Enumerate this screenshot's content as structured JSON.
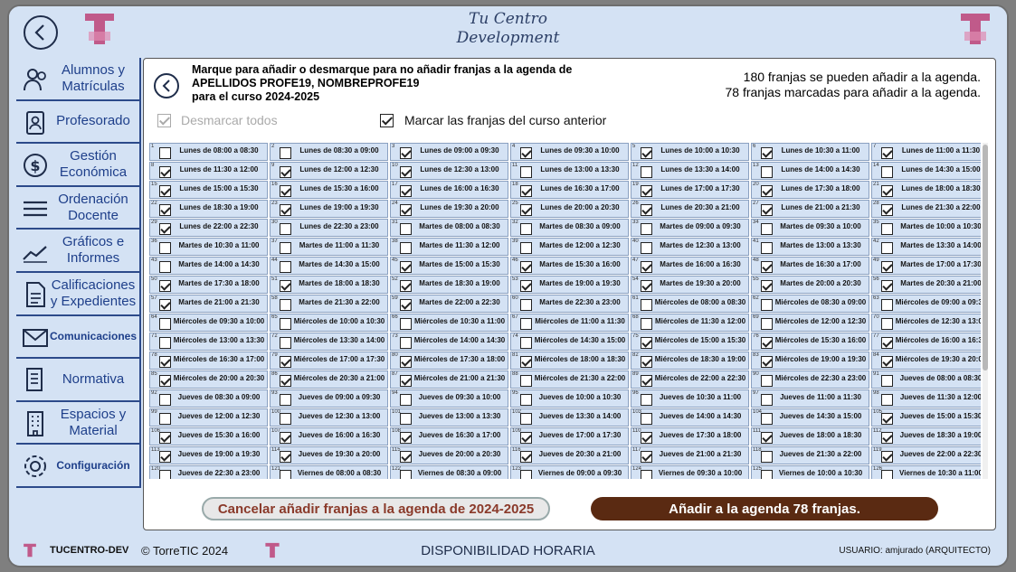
{
  "header": {
    "title_line1": "Tu Centro",
    "title_line2": "Development",
    "logo_text": "TuCentro"
  },
  "sidebar": {
    "items": [
      {
        "label": "Alumnos y Matrículas",
        "icon": "users-icon"
      },
      {
        "label": "Profesorado",
        "icon": "teacher-icon"
      },
      {
        "label": "Gestión Económica",
        "icon": "money-icon"
      },
      {
        "label": "Ordenación Docente",
        "icon": "list-icon"
      },
      {
        "label": "Gráficos e Informes",
        "icon": "chart-icon"
      },
      {
        "label": "Calificaciones y Expedientes",
        "icon": "document-icon"
      },
      {
        "label": "Comunicaciones",
        "icon": "mail-icon"
      },
      {
        "label": "Normativa",
        "icon": "scroll-icon"
      },
      {
        "label": "Espacios y Material",
        "icon": "building-icon"
      },
      {
        "label": "Configuración",
        "icon": "gear-icon"
      }
    ]
  },
  "main": {
    "instruction_line1": "Marque para añadir o desmarque para no añadir franjas a la agenda de",
    "instruction_line2": "APELLIDOS PROFE19, NOMBREPROFE19",
    "instruction_line3": "para el curso 2024-2025",
    "count_line1": "180 franjas se pueden añadir a la agenda.",
    "count_line2": "78 franjas marcadas para añadir a la agenda.",
    "uncheck_all_label": "Desmarcar todos",
    "mark_previous_label": "Marcar las franjas del curso anterior",
    "cancel_label": "Cancelar añadir franjas a la agenda de 2024-2025",
    "add_label": "Añadir a la agenda 78 franjas."
  },
  "slots": [
    {
      "n": "1",
      "label": "Lunes de 08:00 a 08:30",
      "checked": false
    },
    {
      "n": "2",
      "label": "Lunes de 08:30 a 09:00",
      "checked": false
    },
    {
      "n": "3",
      "label": "Lunes de 09:00 a 09:30",
      "checked": true
    },
    {
      "n": "4",
      "label": "Lunes de 09:30 a 10:00",
      "checked": true
    },
    {
      "n": "5",
      "label": "Lunes de 10:00 a 10:30",
      "checked": true
    },
    {
      "n": "6",
      "label": "Lunes de 10:30 a 11:00",
      "checked": true
    },
    {
      "n": "7",
      "label": "Lunes de 11:00 a 11:30",
      "checked": true
    },
    {
      "n": "8",
      "label": "Lunes de 11:30 a 12:00",
      "checked": true
    },
    {
      "n": "9",
      "label": "Lunes de 12:00 a 12:30",
      "checked": true
    },
    {
      "n": "10",
      "label": "Lunes de 12:30 a 13:00",
      "checked": true
    },
    {
      "n": "11",
      "label": "Lunes de 13:00 a 13:30",
      "checked": false
    },
    {
      "n": "12",
      "label": "Lunes de 13:30 a 14:00",
      "checked": false
    },
    {
      "n": "13",
      "label": "Lunes de 14:00 a 14:30",
      "checked": false
    },
    {
      "n": "14",
      "label": "Lunes de 14:30 a 15:00",
      "checked": false
    },
    {
      "n": "15",
      "label": "Lunes de 15:00 a 15:30",
      "checked": true
    },
    {
      "n": "16",
      "label": "Lunes de 15:30 a 16:00",
      "checked": true
    },
    {
      "n": "17",
      "label": "Lunes de 16:00 a 16:30",
      "checked": true
    },
    {
      "n": "18",
      "label": "Lunes de 16:30 a 17:00",
      "checked": true
    },
    {
      "n": "19",
      "label": "Lunes de 17:00 a 17:30",
      "checked": true
    },
    {
      "n": "20",
      "label": "Lunes de 17:30 a 18:00",
      "checked": true
    },
    {
      "n": "21",
      "label": "Lunes de 18:00 a 18:30",
      "checked": true
    },
    {
      "n": "22",
      "label": "Lunes de 18:30 a 19:00",
      "checked": true
    },
    {
      "n": "23",
      "label": "Lunes de 19:00 a 19:30",
      "checked": true
    },
    {
      "n": "24",
      "label": "Lunes de 19:30 a 20:00",
      "checked": true
    },
    {
      "n": "25",
      "label": "Lunes de 20:00 a 20:30",
      "checked": true
    },
    {
      "n": "26",
      "label": "Lunes de 20:30 a 21:00",
      "checked": true
    },
    {
      "n": "27",
      "label": "Lunes de 21:00 a 21:30",
      "checked": true
    },
    {
      "n": "28",
      "label": "Lunes de 21:30 a 22:00",
      "checked": true
    },
    {
      "n": "29",
      "label": "Lunes de 22:00 a 22:30",
      "checked": true
    },
    {
      "n": "30",
      "label": "Lunes de 22:30 a 23:00",
      "checked": false
    },
    {
      "n": "31",
      "label": "Martes de 08:00 a 08:30",
      "checked": false
    },
    {
      "n": "32",
      "label": "Martes de 08:30 a 09:00",
      "checked": false
    },
    {
      "n": "33",
      "label": "Martes de 09:00 a 09:30",
      "checked": false
    },
    {
      "n": "34",
      "label": "Martes de 09:30 a 10:00",
      "checked": false
    },
    {
      "n": "35",
      "label": "Martes de 10:00 a 10:30",
      "checked": false
    },
    {
      "n": "36",
      "label": "Martes de 10:30 a 11:00",
      "checked": false
    },
    {
      "n": "37",
      "label": "Martes de 11:00 a 11:30",
      "checked": false
    },
    {
      "n": "38",
      "label": "Martes de 11:30 a 12:00",
      "checked": false
    },
    {
      "n": "39",
      "label": "Martes de 12:00 a 12:30",
      "checked": false
    },
    {
      "n": "40",
      "label": "Martes de 12:30 a 13:00",
      "checked": false
    },
    {
      "n": "41",
      "label": "Martes de 13:00 a 13:30",
      "checked": false
    },
    {
      "n": "42",
      "label": "Martes de 13:30 a 14:00",
      "checked": false
    },
    {
      "n": "43",
      "label": "Martes de 14:00 a 14:30",
      "checked": false
    },
    {
      "n": "44",
      "label": "Martes de 14:30 a 15:00",
      "checked": false
    },
    {
      "n": "45",
      "label": "Martes de 15:00 a 15:30",
      "checked": true
    },
    {
      "n": "46",
      "label": "Martes de 15:30 a 16:00",
      "checked": true
    },
    {
      "n": "47",
      "label": "Martes de 16:00 a 16:30",
      "checked": true
    },
    {
      "n": "48",
      "label": "Martes de 16:30 a 17:00",
      "checked": true
    },
    {
      "n": "49",
      "label": "Martes de 17:00 a 17:30",
      "checked": true
    },
    {
      "n": "50",
      "label": "Martes de 17:30 a 18:00",
      "checked": true
    },
    {
      "n": "51",
      "label": "Martes de 18:00 a 18:30",
      "checked": true
    },
    {
      "n": "52",
      "label": "Martes de 18:30 a 19:00",
      "checked": true
    },
    {
      "n": "53",
      "label": "Martes de 19:00 a 19:30",
      "checked": true
    },
    {
      "n": "54",
      "label": "Martes de 19:30 a 20:00",
      "checked": true
    },
    {
      "n": "55",
      "label": "Martes de 20:00 a 20:30",
      "checked": true
    },
    {
      "n": "56",
      "label": "Martes de 20:30 a 21:00",
      "checked": true
    },
    {
      "n": "57",
      "label": "Martes de 21:00 a 21:30",
      "checked": true
    },
    {
      "n": "58",
      "label": "Martes de 21:30 a 22:00",
      "checked": false
    },
    {
      "n": "59",
      "label": "Martes de 22:00 a 22:30",
      "checked": true
    },
    {
      "n": "60",
      "label": "Martes de 22:30 a 23:00",
      "checked": false
    },
    {
      "n": "61",
      "label": "Miércoles de 08:00 a 08:30",
      "checked": false
    },
    {
      "n": "62",
      "label": "Miércoles de 08:30 a 09:00",
      "checked": false
    },
    {
      "n": "63",
      "label": "Miércoles de 09:00 a 09:30",
      "checked": false
    },
    {
      "n": "64",
      "label": "Miércoles de 09:30 a 10:00",
      "checked": false
    },
    {
      "n": "65",
      "label": "Miércoles de 10:00 a 10:30",
      "checked": false
    },
    {
      "n": "66",
      "label": "Miércoles de 10:30 a 11:00",
      "checked": false
    },
    {
      "n": "67",
      "label": "Miércoles de 11:00 a 11:30",
      "checked": false
    },
    {
      "n": "68",
      "label": "Miércoles de 11:30 a 12:00",
      "checked": false
    },
    {
      "n": "69",
      "label": "Miércoles de 12:00 a 12:30",
      "checked": false
    },
    {
      "n": "70",
      "label": "Miércoles de 12:30 a 13:00",
      "checked": false
    },
    {
      "n": "71",
      "label": "Miércoles de 13:00 a 13:30",
      "checked": false
    },
    {
      "n": "72",
      "label": "Miércoles de 13:30 a 14:00",
      "checked": false
    },
    {
      "n": "73",
      "label": "Miércoles de 14:00 a 14:30",
      "checked": false
    },
    {
      "n": "74",
      "label": "Miércoles de 14:30 a 15:00",
      "checked": false
    },
    {
      "n": "75",
      "label": "Miércoles de 15:00 a 15:30",
      "checked": true
    },
    {
      "n": "76",
      "label": "Miércoles de 15:30 a 16:00",
      "checked": true
    },
    {
      "n": "77",
      "label": "Miércoles de 16:00 a 16:30",
      "checked": true
    },
    {
      "n": "78",
      "label": "Miércoles de 16:30 a 17:00",
      "checked": true
    },
    {
      "n": "79",
      "label": "Miércoles de 17:00 a 17:30",
      "checked": true
    },
    {
      "n": "80",
      "label": "Miércoles de 17:30 a 18:00",
      "checked": true
    },
    {
      "n": "81",
      "label": "Miércoles de 18:00 a 18:30",
      "checked": true
    },
    {
      "n": "82",
      "label": "Miércoles de 18:30 a 19:00",
      "checked": true
    },
    {
      "n": "83",
      "label": "Miércoles de 19:00 a 19:30",
      "checked": true
    },
    {
      "n": "84",
      "label": "Miércoles de 19:30 a 20:00",
      "checked": true
    },
    {
      "n": "85",
      "label": "Miércoles de 20:00 a 20:30",
      "checked": true
    },
    {
      "n": "86",
      "label": "Miércoles de 20:30 a 21:00",
      "checked": true
    },
    {
      "n": "87",
      "label": "Miércoles de 21:00 a 21:30",
      "checked": true
    },
    {
      "n": "88",
      "label": "Miércoles de 21:30 a 22:00",
      "checked": false
    },
    {
      "n": "89",
      "label": "Miércoles de 22:00 a 22:30",
      "checked": true
    },
    {
      "n": "90",
      "label": "Miércoles de 22:30 a 23:00",
      "checked": false
    },
    {
      "n": "91",
      "label": "Jueves de 08:00 a 08:30",
      "checked": false
    },
    {
      "n": "92",
      "label": "Jueves de 08:30 a 09:00",
      "checked": false
    },
    {
      "n": "93",
      "label": "Jueves de 09:00 a 09:30",
      "checked": false
    },
    {
      "n": "94",
      "label": "Jueves de 09:30 a 10:00",
      "checked": false
    },
    {
      "n": "95",
      "label": "Jueves de 10:00 a 10:30",
      "checked": false
    },
    {
      "n": "96",
      "label": "Jueves de 10:30 a 11:00",
      "checked": false
    },
    {
      "n": "97",
      "label": "Jueves de 11:00 a 11:30",
      "checked": false
    },
    {
      "n": "98",
      "label": "Jueves de 11:30 a 12:00",
      "checked": false
    },
    {
      "n": "99",
      "label": "Jueves de 12:00 a 12:30",
      "checked": false
    },
    {
      "n": "100",
      "label": "Jueves de 12:30 a 13:00",
      "checked": false
    },
    {
      "n": "101",
      "label": "Jueves de 13:00 a 13:30",
      "checked": false
    },
    {
      "n": "102",
      "label": "Jueves de 13:30 a 14:00",
      "checked": false
    },
    {
      "n": "103",
      "label": "Jueves de 14:00 a 14:30",
      "checked": false
    },
    {
      "n": "104",
      "label": "Jueves de 14:30 a 15:00",
      "checked": false
    },
    {
      "n": "105",
      "label": "Jueves de 15:00 a 15:30",
      "checked": true
    },
    {
      "n": "106",
      "label": "Jueves de 15:30 a 16:00",
      "checked": true
    },
    {
      "n": "107",
      "label": "Jueves de 16:00 a 16:30",
      "checked": true
    },
    {
      "n": "108",
      "label": "Jueves de 16:30 a 17:00",
      "checked": true
    },
    {
      "n": "109",
      "label": "Jueves de 17:00 a 17:30",
      "checked": true
    },
    {
      "n": "110",
      "label": "Jueves de 17:30 a 18:00",
      "checked": true
    },
    {
      "n": "111",
      "label": "Jueves de 18:00 a 18:30",
      "checked": true
    },
    {
      "n": "112",
      "label": "Jueves de 18:30 a 19:00",
      "checked": true
    },
    {
      "n": "113",
      "label": "Jueves de 19:00 a 19:30",
      "checked": true
    },
    {
      "n": "114",
      "label": "Jueves de 19:30 a 20:00",
      "checked": true
    },
    {
      "n": "115",
      "label": "Jueves de 20:00 a 20:30",
      "checked": true
    },
    {
      "n": "116",
      "label": "Jueves de 20:30 a 21:00",
      "checked": true
    },
    {
      "n": "117",
      "label": "Jueves de 21:00 a 21:30",
      "checked": true
    },
    {
      "n": "118",
      "label": "Jueves de 21:30 a 22:00",
      "checked": false
    },
    {
      "n": "119",
      "label": "Jueves de 22:00 a 22:30",
      "checked": true
    },
    {
      "n": "120",
      "label": "Jueves de 22:30 a 23:00",
      "checked": false
    },
    {
      "n": "121",
      "label": "Viernes de 08:00 a 08:30",
      "checked": false
    },
    {
      "n": "122",
      "label": "Viernes de 08:30 a 09:00",
      "checked": false
    },
    {
      "n": "123",
      "label": "Viernes de 09:00 a 09:30",
      "checked": false
    },
    {
      "n": "124",
      "label": "Viernes de 09:30 a 10:00",
      "checked": false
    },
    {
      "n": "125",
      "label": "Viernes de 10:00 a 10:30",
      "checked": false
    },
    {
      "n": "126",
      "label": "Viernes de 10:30 a 11:00",
      "checked": false
    }
  ],
  "footer": {
    "app_name": "TUCENTRO-DEV",
    "copyright": "© TorreTIC 2024",
    "section": "DISPONIBILIDAD HORARIA",
    "user": "USUARIO: amjurado (ARQUITECTO)"
  },
  "colors": {
    "background": "#d4e2f4",
    "sidebar_text": "#1e3f8a",
    "add_button": "#5a2a12",
    "cancel_text": "#8a3a2a"
  }
}
